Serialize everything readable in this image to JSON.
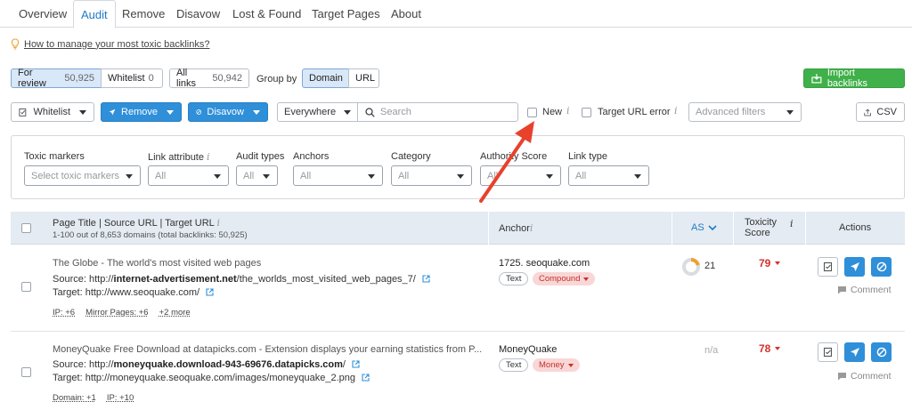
{
  "tabs": [
    "Overview",
    "Audit",
    "Remove",
    "Disavow",
    "Lost & Found",
    "Target Pages",
    "About"
  ],
  "tip": {
    "text": "How to manage your most toxic backlinks?"
  },
  "view_filters": {
    "for_review": {
      "label": "For review",
      "count": "50,925"
    },
    "whitelist": {
      "label": "Whitelist",
      "count": "0"
    },
    "all_links": {
      "label": "All links",
      "count": "50,942"
    },
    "group_by_label": "Group by",
    "domain": "Domain",
    "url": "URL"
  },
  "import_button": "Import backlinks",
  "toolbar": {
    "whitelist": "Whitelist",
    "remove": "Remove",
    "disavow": "Disavow",
    "scope": "Everywhere",
    "search_placeholder": "Search",
    "new_label": "New",
    "target_url_error": "Target URL error",
    "advanced_filters": "Advanced filters",
    "csv": "CSV"
  },
  "filters": {
    "toxic_markers": {
      "label": "Toxic markers",
      "placeholder": "Select toxic markers"
    },
    "link_attribute": {
      "label": "Link attribute",
      "value": "All"
    },
    "audit_types": {
      "label": "Audit types",
      "value": "All"
    },
    "anchors": {
      "label": "Anchors",
      "value": "All"
    },
    "category": {
      "label": "Category",
      "value": "All"
    },
    "authority_score": {
      "label": "Authority Score",
      "value": "All"
    },
    "link_type": {
      "label": "Link type",
      "value": "All"
    }
  },
  "table": {
    "col_page": "Page Title | Source URL | Target URL",
    "summary": "1-100 out of 8,653 domains (total backlinks: 50,925)",
    "col_anchor": "Anchor",
    "col_as": "AS",
    "col_toxicity_1": "Toxicity",
    "col_toxicity_2": "Score",
    "col_actions": "Actions",
    "source_label": "Source:",
    "target_label": "Target:",
    "comment_label": "Comment",
    "rows": [
      {
        "title": "The Globe - The world's most visited web pages",
        "source_prefix": "http://",
        "source_bold": "internet-advertisement.net",
        "source_rest": "/the_worlds_most_visited_web_pages_7/",
        "target": "http://www.seoquake.com/",
        "meta1": "IP: +6",
        "meta2": "Mirror Pages: +6",
        "meta3": "+2 more",
        "anchor": "1725. seoquake.com",
        "badge1": "Text",
        "badge2": "Compound",
        "as": "21",
        "as_fraction": 0.21,
        "toxicity": "79"
      },
      {
        "title": "MoneyQuake Free Download at datapicks.com - Extension displays your earning statistics from P...",
        "source_prefix": "http://",
        "source_bold": "moneyquake.download-943-69676.datapicks.com",
        "source_rest": "/",
        "target": "http://moneyquake.seoquake.com/images/moneyquake_2.png",
        "meta1": "Domain: +1",
        "meta2": "IP: +10",
        "anchor": "MoneyQuake",
        "badge1": "Text",
        "badge2": "Money",
        "as": "n/a",
        "toxicity": "78"
      }
    ]
  },
  "colors": {
    "accent": "#1e7bc7",
    "blue_button": "#2f8fd8",
    "green_button": "#40b14a",
    "toxic_red": "#d4302b",
    "arrow": "#e8412c"
  }
}
